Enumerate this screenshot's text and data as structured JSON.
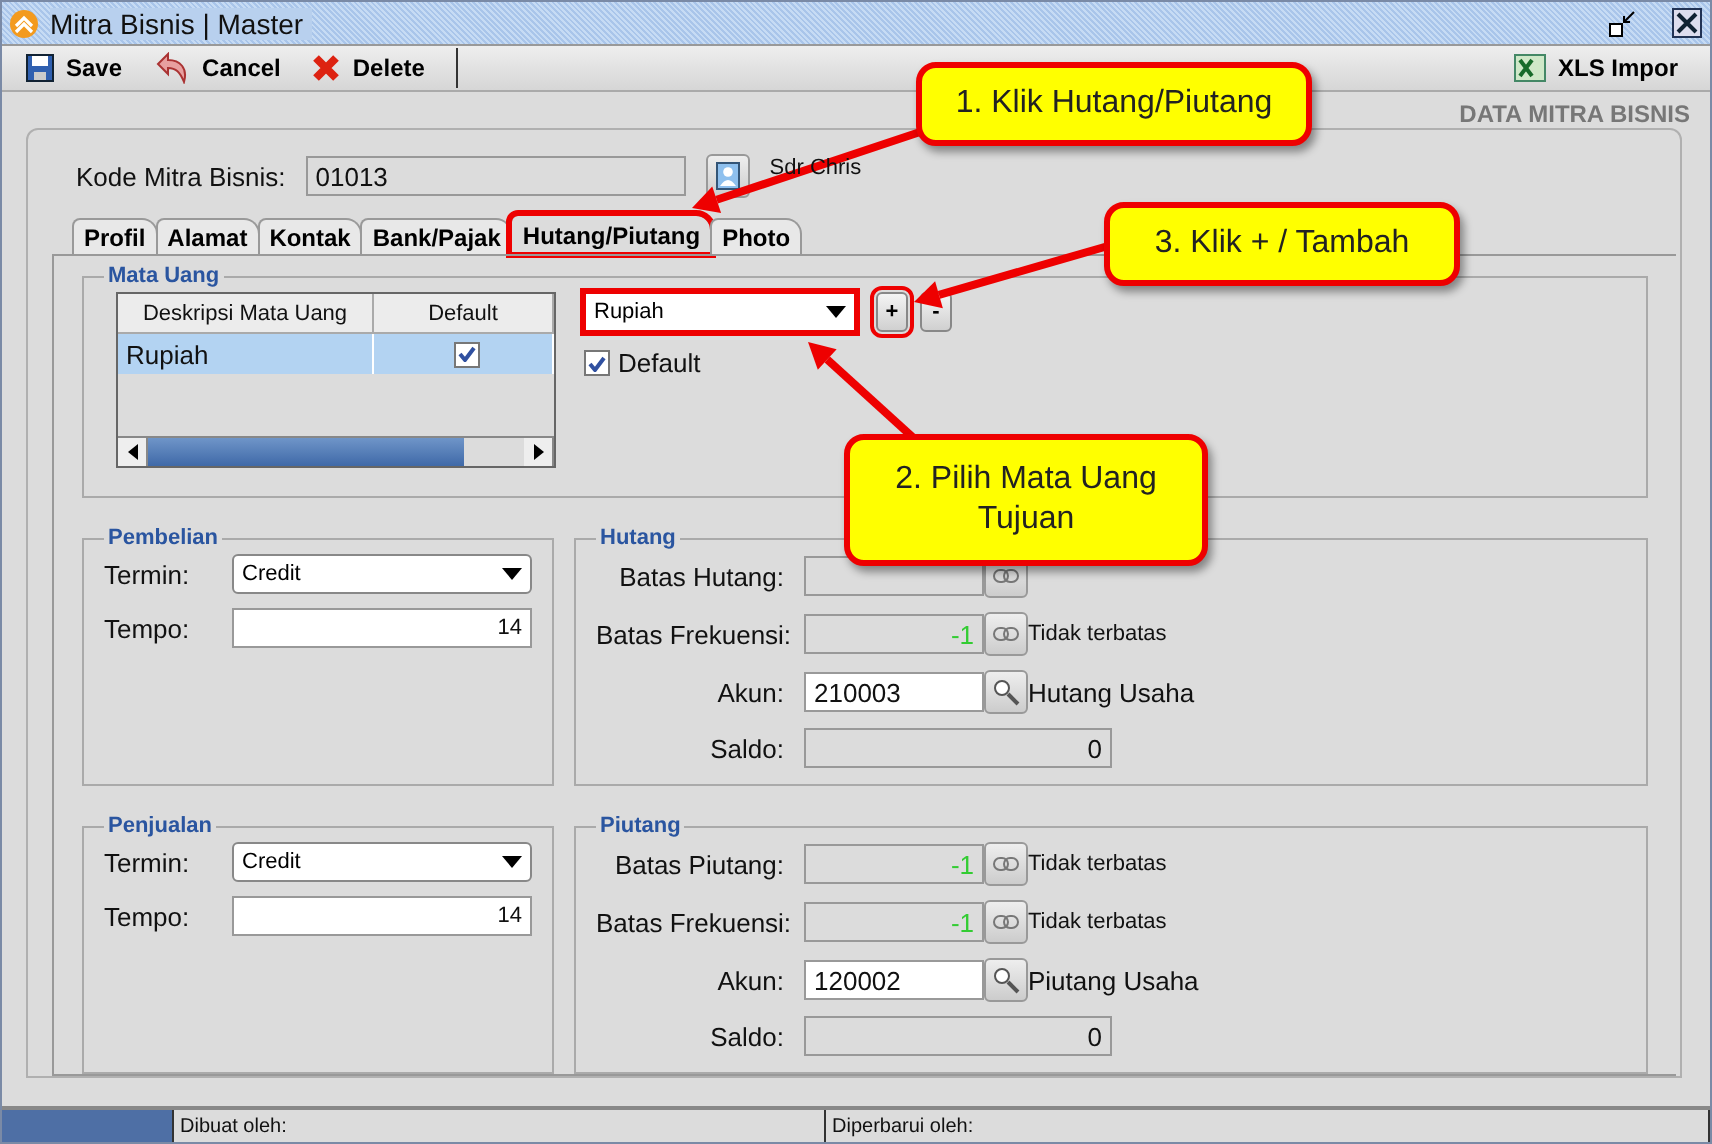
{
  "window": {
    "title": "Mitra Bisnis | Master"
  },
  "toolbar": {
    "buttons": [
      {
        "label": "Save",
        "kind": "save"
      },
      {
        "label": "Cancel",
        "kind": "cancel"
      },
      {
        "label": "Delete",
        "kind": "delete"
      }
    ],
    "import_button": "XLS Impor"
  },
  "header": "DATA MITRA BISNIS",
  "kode": {
    "label": "Kode Mitra Bisnis:",
    "value": "01013",
    "note": "Sdr Chris"
  },
  "tabs": [
    {
      "label": "Profil",
      "selected": false
    },
    {
      "label": "Alamat",
      "selected": false
    },
    {
      "label": "Kontak",
      "selected": false
    },
    {
      "label": "Bank/Pajak",
      "selected": false
    },
    {
      "label": "Hutang/Piutang",
      "selected": true
    },
    {
      "label": "Photo",
      "selected": false
    }
  ],
  "mata_uang": {
    "title": "Mata Uang",
    "columns": [
      "Deskripsi Mata Uang",
      "Default"
    ],
    "rows": [
      {
        "name": "Rupiah",
        "default": true,
        "selected": true
      }
    ],
    "select": "Rupiah",
    "add_button": "+",
    "remove_button": "-",
    "default_checkbox": {
      "label": "Default",
      "checked": true
    }
  },
  "sections": [
    {
      "title": "Pembelian",
      "kind": "terms",
      "termin_label": "Termin:",
      "termin": "Credit",
      "tempo_label": "Tempo:",
      "tempo": "14"
    },
    {
      "title": "Hutang",
      "kind": "limits",
      "rows": [
        {
          "kind": "limit",
          "label": "Batas Hutang:"
        },
        {
          "kind": "limit",
          "label": "Batas Frekuensi:",
          "value": "-1",
          "note": "Tidak terbatas"
        },
        {
          "kind": "account",
          "label": "Akun:",
          "value": "210003",
          "name": "Hutang Usaha"
        },
        {
          "kind": "readonly",
          "label": "Saldo:",
          "value": "0"
        }
      ]
    },
    {
      "title": "Penjualan",
      "kind": "terms",
      "termin_label": "Termin:",
      "termin": "Credit",
      "tempo_label": "Tempo:",
      "tempo": "14"
    },
    {
      "title": "Piutang",
      "kind": "limits",
      "rows": [
        {
          "kind": "limit",
          "label": "Batas Piutang:",
          "value": "-1",
          "note": "Tidak terbatas"
        },
        {
          "kind": "limit",
          "label": "Batas Frekuensi:",
          "value": "-1",
          "note": "Tidak terbatas"
        },
        {
          "kind": "account",
          "label": "Akun:",
          "value": "120002",
          "name": "Piutang Usaha"
        },
        {
          "kind": "readonly",
          "label": "Saldo:",
          "value": "0"
        }
      ]
    }
  ],
  "progress": {
    "level": 1
  },
  "status_bar": [
    "Dibuat oleh:",
    "Diperbarui oleh:"
  ],
  "callouts": [
    "1. Klik Hutang/Piutang",
    "3. Klik + / Tambah",
    "2. Pilih Mata Uang Tujuan"
  ]
}
